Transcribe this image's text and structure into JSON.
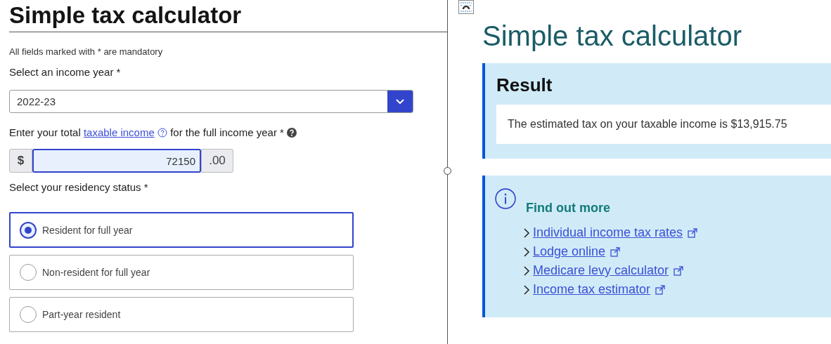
{
  "left": {
    "title": "Simple tax calculator",
    "mandatory_note": "All fields marked with * are mandatory",
    "year_select": {
      "label": "Select an income year *",
      "value": "2022-23"
    },
    "income": {
      "label_before": "Enter your total ",
      "link": "taxable income",
      "label_after": " for the full income year *",
      "prefix": "$",
      "value": "72150",
      "suffix": ".00"
    },
    "residency": {
      "label": "Select your residency status *",
      "options": [
        {
          "label": "Resident for full year",
          "selected": true
        },
        {
          "label": "Non-resident for full year",
          "selected": false
        },
        {
          "label": "Part-year resident",
          "selected": false
        }
      ]
    }
  },
  "right": {
    "title": "Simple tax calculator",
    "result": {
      "heading": "Result",
      "text": "The estimated tax on your taxable income is $13,915.75"
    },
    "info": {
      "heading": "Find out more",
      "links": [
        {
          "label": "Individual income tax rates",
          "external": true
        },
        {
          "label": "Lodge online",
          "external": true
        },
        {
          "label": "Medicare levy calculator",
          "external": true
        },
        {
          "label": "Income tax estimator",
          "external": true
        }
      ]
    }
  }
}
